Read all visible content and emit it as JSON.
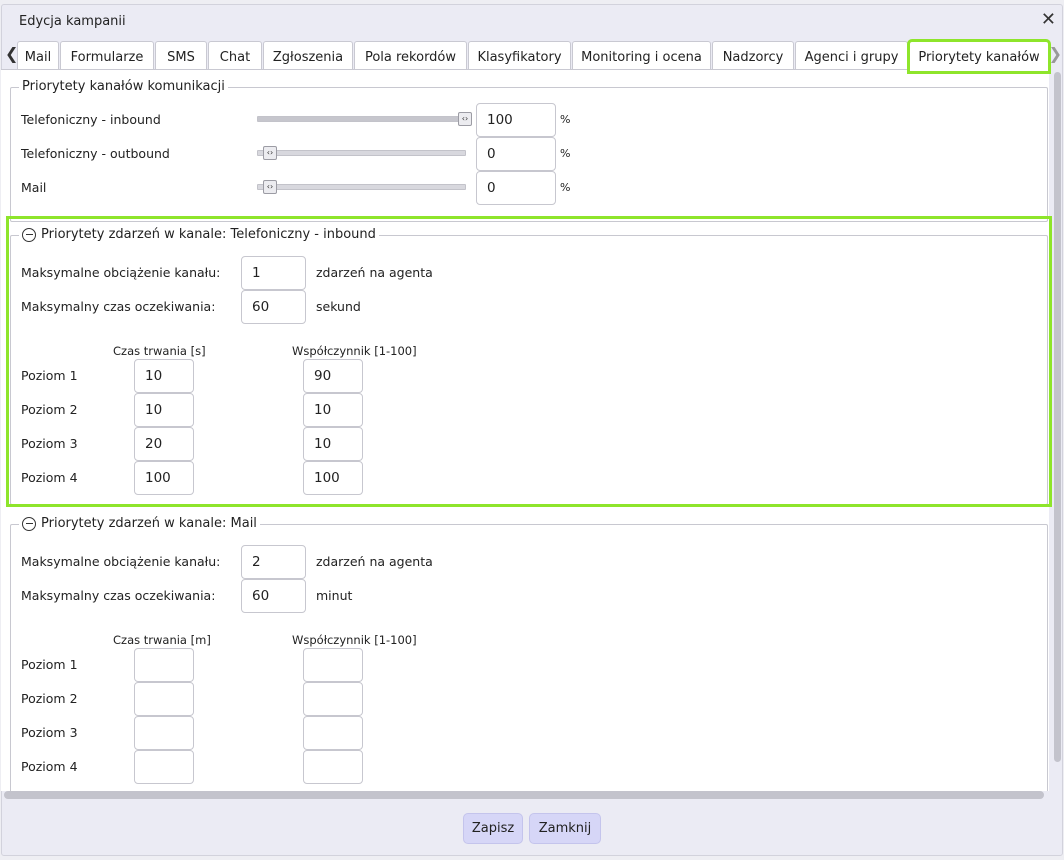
{
  "window": {
    "title": "Edycja kampanii"
  },
  "tabs": [
    {
      "label": "Mail"
    },
    {
      "label": "Formularze"
    },
    {
      "label": "SMS"
    },
    {
      "label": "Chat"
    },
    {
      "label": "Zgłoszenia"
    },
    {
      "label": "Pola rekordów"
    },
    {
      "label": "Klasyfikatory"
    },
    {
      "label": "Monitoring i ocena"
    },
    {
      "label": "Nadzorcy"
    },
    {
      "label": "Agenci i grupy"
    },
    {
      "label": "Priorytety kanałów",
      "active": true
    }
  ],
  "channel_priorities": {
    "legend": "Priorytety kanałów komunikacji",
    "unit": "%",
    "rows": [
      {
        "label": "Telefoniczny - inbound",
        "value": "100",
        "level": 100
      },
      {
        "label": "Telefoniczny - outbound",
        "value": "0",
        "level": 0
      },
      {
        "label": "Mail",
        "value": "0",
        "level": 0
      }
    ]
  },
  "section_phone": {
    "legend": "Priorytety zdarzeń w kanale: Telefoniczny - inbound",
    "max_load_label": "Maksymalne obciążenie kanału:",
    "max_load_value": "1",
    "max_load_unit": "zdarzeń na agenta",
    "max_wait_label": "Maksymalny czas oczekiwania:",
    "max_wait_value": "60",
    "max_wait_unit": "sekund",
    "col_duration": "Czas trwania [s]",
    "col_factor": "Współczynnik [1-100]",
    "levels": [
      {
        "label": "Poziom 1",
        "duration": "10",
        "factor": "90"
      },
      {
        "label": "Poziom 2",
        "duration": "10",
        "factor": "10"
      },
      {
        "label": "Poziom 3",
        "duration": "20",
        "factor": "10"
      },
      {
        "label": "Poziom 4",
        "duration": "100",
        "factor": "100"
      }
    ]
  },
  "section_mail": {
    "legend": "Priorytety zdarzeń w kanale: Mail",
    "max_load_label": "Maksymalne obciążenie kanału:",
    "max_load_value": "2",
    "max_load_unit": "zdarzeń na agenta",
    "max_wait_label": "Maksymalny czas oczekiwania:",
    "max_wait_value": "60",
    "max_wait_unit": "minut",
    "col_duration": "Czas trwania [m]",
    "col_factor": "Współczynnik [1-100]",
    "levels": [
      {
        "label": "Poziom 1",
        "duration": "",
        "factor": ""
      },
      {
        "label": "Poziom 2",
        "duration": "",
        "factor": ""
      },
      {
        "label": "Poziom 3",
        "duration": "",
        "factor": ""
      },
      {
        "label": "Poziom 4",
        "duration": "",
        "factor": ""
      }
    ]
  },
  "buttons": {
    "save": "Zapisz",
    "close": "Zamknij"
  },
  "colors": {
    "highlight": "#8ee52b",
    "button_bg": "#d6d6f7"
  }
}
